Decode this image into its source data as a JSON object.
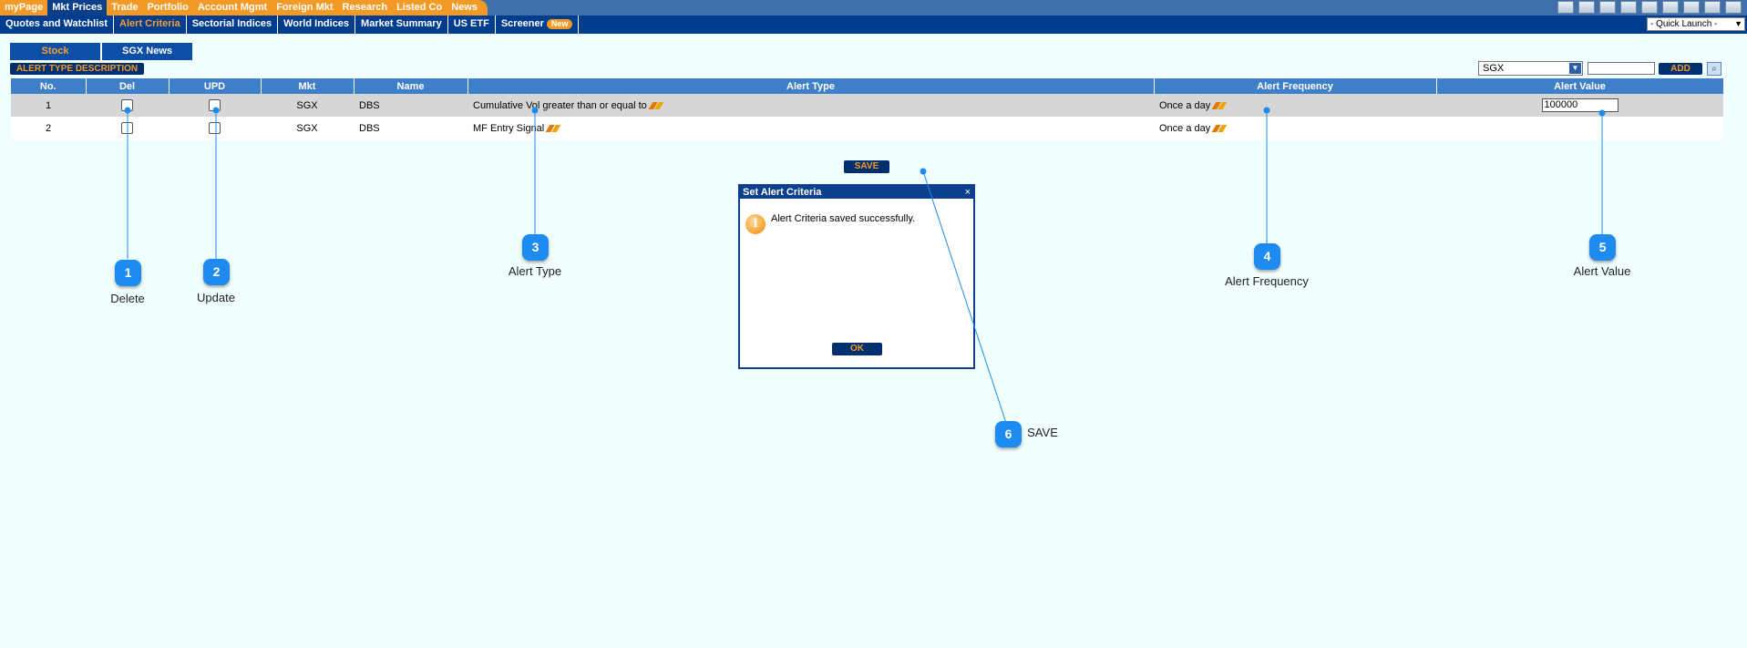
{
  "top_nav": [
    "myPage",
    "Mkt Prices",
    "Trade",
    "Portfolio",
    "Account Mgmt",
    "Foreign Mkt",
    "Research",
    "Listed Co",
    "News"
  ],
  "top_nav_active": "Mkt Prices",
  "sub_nav": [
    "Quotes and Watchlist",
    "Alert Criteria",
    "Sectorial Indices",
    "World Indices",
    "Market Summary",
    "US ETF",
    "Screener"
  ],
  "sub_nav_active": "Alert Criteria",
  "new_badge": "New",
  "quick_launch": "- Quick Launch -",
  "tabs": [
    "Stock",
    "SGX News"
  ],
  "alert_type_description_btn": "ALERT TYPE DESCRIPTION",
  "market_select": "SGX",
  "add_btn": "ADD",
  "table": {
    "headers": [
      "No.",
      "Del",
      "UPD",
      "Mkt",
      "Name",
      "Alert Type",
      "Alert Frequency",
      "Alert Value"
    ],
    "rows": [
      {
        "no": "1",
        "mkt": "SGX",
        "name": "DBS",
        "alert_type": "Cumulative Vol greater than or equal to",
        "frequency": "Once a day",
        "value": "100000"
      },
      {
        "no": "2",
        "mkt": "SGX",
        "name": "DBS",
        "alert_type": "MF Entry Signal",
        "frequency": "Once a day",
        "value": ""
      }
    ]
  },
  "save_btn": "SAVE",
  "dialog": {
    "title": "Set Alert Criteria",
    "close": "×",
    "message": "Alert Criteria saved successfully.",
    "ok": "OK"
  },
  "callouts": [
    {
      "num": "1",
      "label": "Delete"
    },
    {
      "num": "2",
      "label": "Update"
    },
    {
      "num": "3",
      "label": "Alert Type"
    },
    {
      "num": "4",
      "label": "Alert Frequency"
    },
    {
      "num": "5",
      "label": "Alert Value"
    },
    {
      "num": "6",
      "label": "SAVE"
    }
  ]
}
